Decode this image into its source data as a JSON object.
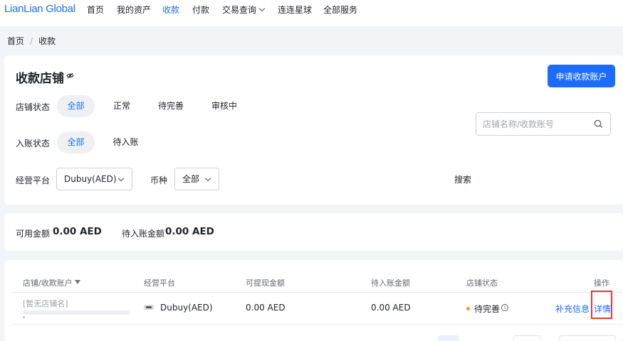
{
  "brand": {
    "logo": "LianLian Global",
    "accent": "#1c6dff",
    "highlight": "#e53935",
    "pending_dot": "#f29b1b"
  },
  "nav": {
    "home": "首页",
    "assets": "我的资产",
    "receive": "收款",
    "pay": "付款",
    "tx_query": "交易查询",
    "global": "连连星球",
    "all_services": "全部服务"
  },
  "breadcrumb": {
    "home": "首页",
    "current": "收款"
  },
  "page": {
    "title": "收款店铺",
    "apply_button": "申请收款账户"
  },
  "filters": {
    "store_status_label": "店铺状态",
    "store_status_options": [
      "全部",
      "正常",
      "待完善",
      "审核中"
    ],
    "store_status_selected": "全部",
    "credit_status_label": "入账状态",
    "credit_status_options": [
      "全部",
      "待入账"
    ],
    "credit_status_selected": "全部",
    "platform_label": "经营平台",
    "platform_value": "Dubuy(AED)",
    "currency_label": "币种",
    "currency_value": "全部",
    "search_label": "搜索",
    "search_placeholder": "店铺名称/收款账号"
  },
  "balances": {
    "available_label": "可用金额",
    "available_value": "0.00 AED",
    "pending_label": "待入账金额",
    "pending_value": "0.00 AED"
  },
  "table": {
    "headers": {
      "store": "店铺/收款账户",
      "platform": "经营平台",
      "withdrawable": "可提现金额",
      "pending": "待入账金额",
      "status": "店铺状态",
      "action": "操作"
    },
    "rows": [
      {
        "store": "[暂无店铺名]",
        "platform": "Dubuy(AED)",
        "withdrawable": "0.00 AED",
        "pending": "0.00 AED",
        "status": "待完善",
        "status_icon": "info-icon",
        "action_supplement": "补充信息",
        "action_detail": "详情"
      }
    ]
  }
}
